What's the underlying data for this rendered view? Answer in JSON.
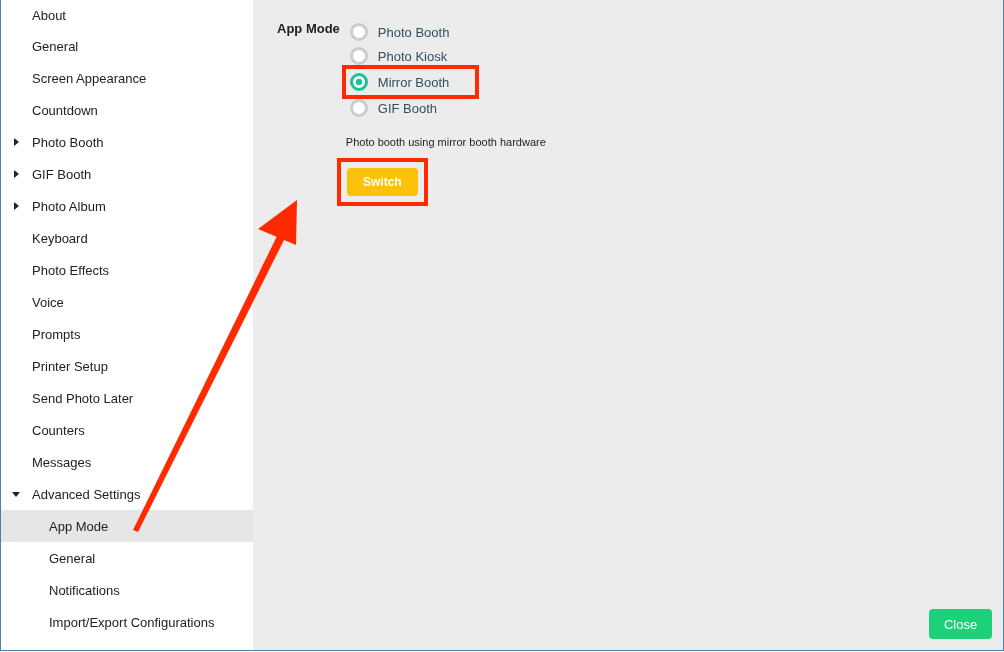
{
  "sidebar": {
    "items": [
      {
        "label": "About",
        "kind": "leaf",
        "selected": false
      },
      {
        "label": "General",
        "kind": "leaf",
        "selected": false
      },
      {
        "label": "Screen Appearance",
        "kind": "leaf",
        "selected": false
      },
      {
        "label": "Countdown",
        "kind": "leaf",
        "selected": false
      },
      {
        "label": "Photo Booth",
        "kind": "group",
        "expanded": false,
        "selected": false
      },
      {
        "label": "GIF Booth",
        "kind": "group",
        "expanded": false,
        "selected": false
      },
      {
        "label": "Photo Album",
        "kind": "group",
        "expanded": false,
        "selected": false
      },
      {
        "label": "Keyboard",
        "kind": "leaf",
        "selected": false
      },
      {
        "label": "Photo Effects",
        "kind": "leaf",
        "selected": false
      },
      {
        "label": "Voice",
        "kind": "leaf",
        "selected": false
      },
      {
        "label": "Prompts",
        "kind": "leaf",
        "selected": false
      },
      {
        "label": "Printer Setup",
        "kind": "leaf",
        "selected": false
      },
      {
        "label": "Send Photo Later",
        "kind": "leaf",
        "selected": false
      },
      {
        "label": "Counters",
        "kind": "leaf",
        "selected": false
      },
      {
        "label": "Messages",
        "kind": "leaf",
        "selected": false
      },
      {
        "label": "Advanced Settings",
        "kind": "group",
        "expanded": true,
        "selected": false,
        "children": [
          {
            "label": "App Mode",
            "kind": "leaf",
            "selected": true
          },
          {
            "label": "General",
            "kind": "leaf",
            "selected": false
          },
          {
            "label": "Notifications",
            "kind": "leaf",
            "selected": false
          },
          {
            "label": "Import/Export Configurations",
            "kind": "leaf",
            "selected": false
          }
        ]
      }
    ]
  },
  "app_mode": {
    "label": "App Mode",
    "options": [
      {
        "label": "Photo Booth",
        "selected": false,
        "highlighted": false
      },
      {
        "label": "Photo Kiosk",
        "selected": false,
        "highlighted": false
      },
      {
        "label": "Mirror Booth",
        "selected": true,
        "highlighted": true
      },
      {
        "label": "GIF Booth",
        "selected": false,
        "highlighted": false
      }
    ],
    "description": "Photo booth using mirror booth hardware",
    "switch_button": {
      "label": "Switch",
      "highlighted": true
    }
  },
  "close_button": "Close"
}
